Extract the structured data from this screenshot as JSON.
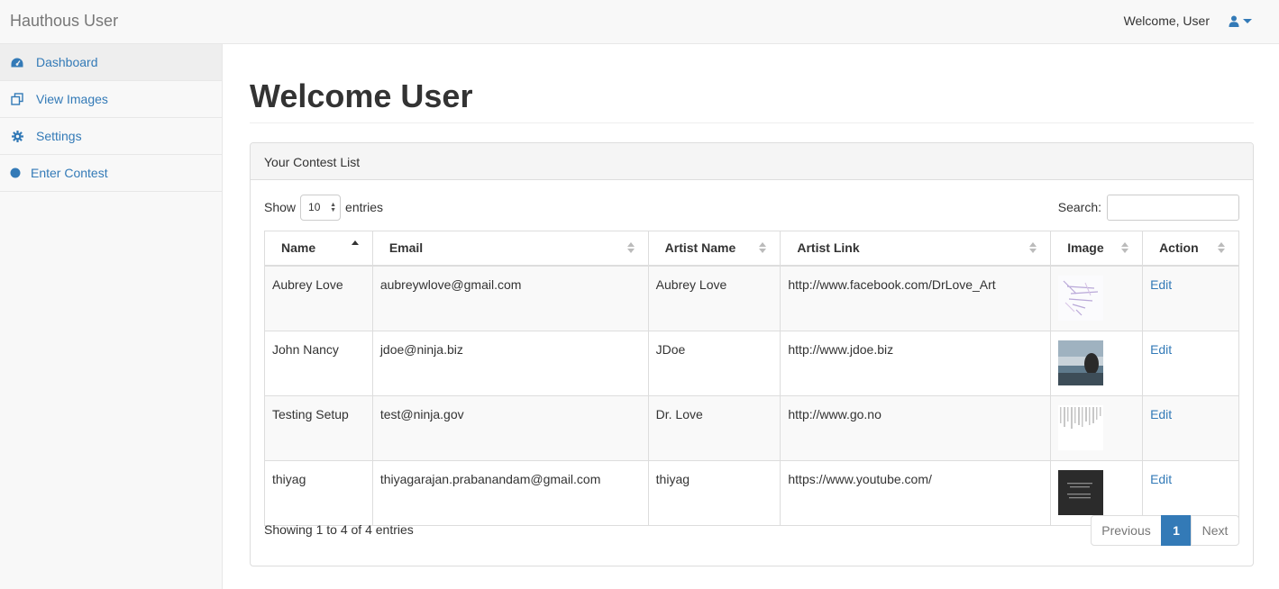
{
  "navbar": {
    "brand": "Hauthous User",
    "welcome": "Welcome, User",
    "user_icon": "user-icon"
  },
  "sidebar": {
    "items": [
      {
        "label": "Dashboard",
        "icon": "dashboard-icon",
        "active": true
      },
      {
        "label": "View Images",
        "icon": "images-icon"
      },
      {
        "label": "Settings",
        "icon": "gear-icon"
      },
      {
        "label": "Enter Contest",
        "icon": "circle-icon"
      }
    ]
  },
  "page": {
    "title": "Welcome User"
  },
  "panel": {
    "heading": "Your Contest List",
    "show_label": "Show",
    "entries_value": "10",
    "entries_label": "entries",
    "search_label": "Search:",
    "search_value": ""
  },
  "table": {
    "columns": [
      "Name",
      "Email",
      "Artist Name",
      "Artist Link",
      "Image",
      "Action"
    ],
    "rows": [
      {
        "name": "Aubrey Love",
        "email": "aubreywlove@gmail.com",
        "artist": "Aubrey Love",
        "link": "http://www.facebook.com/DrLove_Art",
        "action": "Edit"
      },
      {
        "name": "John Nancy",
        "email": "jdoe@ninja.biz",
        "artist": "JDoe",
        "link": "http://www.jdoe.biz",
        "action": "Edit"
      },
      {
        "name": "Testing Setup",
        "email": "test@ninja.gov",
        "artist": "Dr. Love",
        "link": "http://www.go.no",
        "action": "Edit"
      },
      {
        "name": "thiyag",
        "email": "thiyagarajan.prabanandam@gmail.com",
        "artist": "thiyag",
        "link": "https://www.youtube.com/",
        "action": "Edit"
      }
    ]
  },
  "footer": {
    "info": "Showing 1 to 4 of 4 entries",
    "previous": "Previous",
    "current_page": "1",
    "next": "Next"
  },
  "colors": {
    "link": "#337ab7",
    "navbar_bg": "#f8f8f8",
    "border": "#dddddd"
  }
}
